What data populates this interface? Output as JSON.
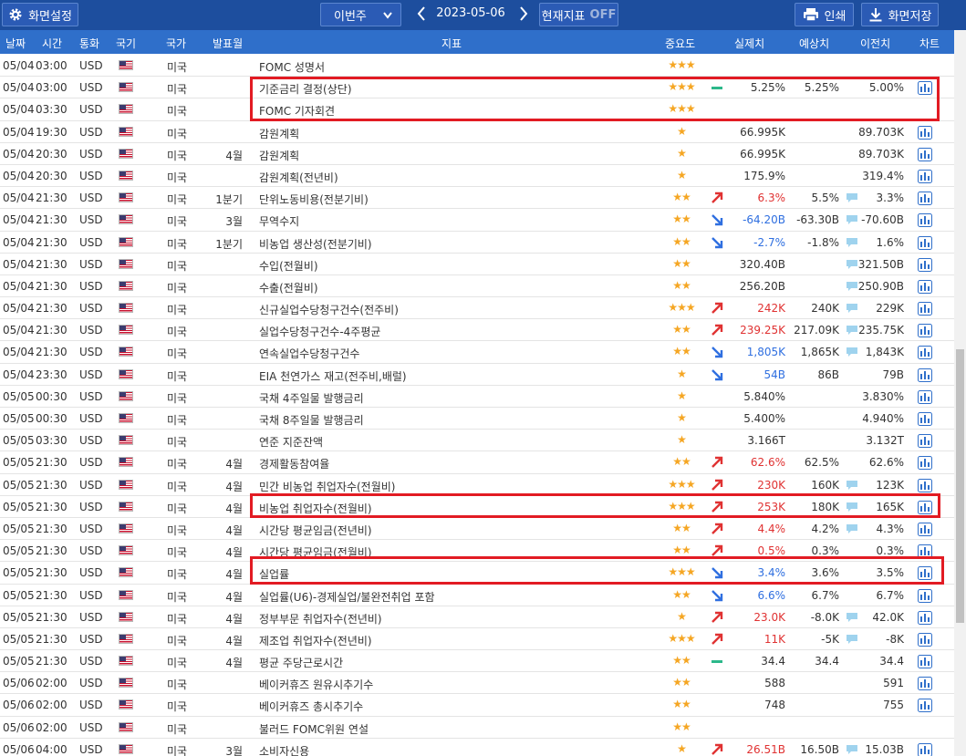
{
  "toolbar": {
    "settings_label": "화면설정",
    "week_select": "이번주",
    "date": "2023-05-06",
    "current_indicator_label": "현재지표",
    "current_indicator_state": "OFF",
    "print_label": "인쇄",
    "save_label": "화면저장"
  },
  "columns": {
    "date": "날짜",
    "time": "시간",
    "currency": "통화",
    "flag": "국기",
    "country": "국가",
    "release_month": "발표월",
    "indicator": "지표",
    "importance": "중요도",
    "actual": "실제치",
    "forecast": "예상치",
    "previous": "이전치",
    "chart": "차트"
  },
  "colors": {
    "toolbar": "#1d4e9e",
    "header": "#2f6fca",
    "star": "#f5a623",
    "up": "#e03232",
    "down": "#2f6fe0",
    "highlight": "#e21b23"
  },
  "rows": [
    {
      "date": "05/04",
      "time": "03:00",
      "currency": "USD",
      "country": "미국",
      "month": "",
      "name": "FOMC 성명서",
      "stars": 3,
      "trend": "",
      "actual": "",
      "actual_dir": "",
      "forecast": "",
      "bubble": false,
      "previous": "",
      "chart": false
    },
    {
      "date": "05/04",
      "time": "03:00",
      "currency": "USD",
      "country": "미국",
      "month": "",
      "name": "기준금리 결정(상단)",
      "stars": 3,
      "trend": "flat",
      "actual": "5.25%",
      "actual_dir": "",
      "forecast": "5.25%",
      "bubble": false,
      "previous": "5.00%",
      "chart": true
    },
    {
      "date": "05/04",
      "time": "03:30",
      "currency": "USD",
      "country": "미국",
      "month": "",
      "name": "FOMC 기자회견",
      "stars": 3,
      "trend": "",
      "actual": "",
      "actual_dir": "",
      "forecast": "",
      "bubble": false,
      "previous": "",
      "chart": false
    },
    {
      "date": "05/04",
      "time": "19:30",
      "currency": "USD",
      "country": "미국",
      "month": "",
      "name": "감원계획",
      "stars": 1,
      "trend": "",
      "actual": "66.995K",
      "actual_dir": "",
      "forecast": "",
      "bubble": false,
      "previous": "89.703K",
      "chart": true
    },
    {
      "date": "05/04",
      "time": "20:30",
      "currency": "USD",
      "country": "미국",
      "month": "4월",
      "name": "감원계획",
      "stars": 1,
      "trend": "",
      "actual": "66.995K",
      "actual_dir": "",
      "forecast": "",
      "bubble": false,
      "previous": "89.703K",
      "chart": true
    },
    {
      "date": "05/04",
      "time": "20:30",
      "currency": "USD",
      "country": "미국",
      "month": "",
      "name": "감원계획(전년비)",
      "stars": 1,
      "trend": "",
      "actual": "175.9%",
      "actual_dir": "",
      "forecast": "",
      "bubble": false,
      "previous": "319.4%",
      "chart": true
    },
    {
      "date": "05/04",
      "time": "21:30",
      "currency": "USD",
      "country": "미국",
      "month": "1분기",
      "name": "단위노동비용(전분기비)",
      "stars": 2,
      "trend": "up",
      "actual": "6.3%",
      "actual_dir": "up",
      "forecast": "5.5%",
      "bubble": true,
      "previous": "3.3%",
      "chart": true
    },
    {
      "date": "05/04",
      "time": "21:30",
      "currency": "USD",
      "country": "미국",
      "month": "3월",
      "name": "무역수지",
      "stars": 2,
      "trend": "down",
      "actual": "-64.20B",
      "actual_dir": "down",
      "forecast": "-63.30B",
      "bubble": true,
      "previous": "-70.60B",
      "chart": true
    },
    {
      "date": "05/04",
      "time": "21:30",
      "currency": "USD",
      "country": "미국",
      "month": "1분기",
      "name": "비농업 생산성(전분기비)",
      "stars": 2,
      "trend": "down",
      "actual": "-2.7%",
      "actual_dir": "down",
      "forecast": "-1.8%",
      "bubble": true,
      "previous": "1.6%",
      "chart": true
    },
    {
      "date": "05/04",
      "time": "21:30",
      "currency": "USD",
      "country": "미국",
      "month": "",
      "name": "수입(전월비)",
      "stars": 2,
      "trend": "",
      "actual": "320.40B",
      "actual_dir": "",
      "forecast": "",
      "bubble": true,
      "previous": "321.50B",
      "chart": true
    },
    {
      "date": "05/04",
      "time": "21:30",
      "currency": "USD",
      "country": "미국",
      "month": "",
      "name": "수출(전월비)",
      "stars": 2,
      "trend": "",
      "actual": "256.20B",
      "actual_dir": "",
      "forecast": "",
      "bubble": true,
      "previous": "250.90B",
      "chart": true
    },
    {
      "date": "05/04",
      "time": "21:30",
      "currency": "USD",
      "country": "미국",
      "month": "",
      "name": "신규실업수당청구건수(전주비)",
      "stars": 3,
      "trend": "up",
      "actual": "242K",
      "actual_dir": "up",
      "forecast": "240K",
      "bubble": true,
      "previous": "229K",
      "chart": true
    },
    {
      "date": "05/04",
      "time": "21:30",
      "currency": "USD",
      "country": "미국",
      "month": "",
      "name": "실업수당청구건수-4주평균",
      "stars": 2,
      "trend": "up",
      "actual": "239.25K",
      "actual_dir": "up",
      "forecast": "217.09K",
      "bubble": true,
      "previous": "235.75K",
      "chart": true
    },
    {
      "date": "05/04",
      "time": "21:30",
      "currency": "USD",
      "country": "미국",
      "month": "",
      "name": "연속실업수당청구건수",
      "stars": 2,
      "trend": "down",
      "actual": "1,805K",
      "actual_dir": "down",
      "forecast": "1,865K",
      "bubble": true,
      "previous": "1,843K",
      "chart": true
    },
    {
      "date": "05/04",
      "time": "23:30",
      "currency": "USD",
      "country": "미국",
      "month": "",
      "name": "EIA 천연가스 재고(전주비,배럴)",
      "stars": 1,
      "trend": "down",
      "actual": "54B",
      "actual_dir": "down",
      "forecast": "86B",
      "bubble": false,
      "previous": "79B",
      "chart": true
    },
    {
      "date": "05/05",
      "time": "00:30",
      "currency": "USD",
      "country": "미국",
      "month": "",
      "name": "국채 4주일물 발행금리",
      "stars": 1,
      "trend": "",
      "actual": "5.840%",
      "actual_dir": "",
      "forecast": "",
      "bubble": false,
      "previous": "3.830%",
      "chart": true
    },
    {
      "date": "05/05",
      "time": "00:30",
      "currency": "USD",
      "country": "미국",
      "month": "",
      "name": "국채 8주일물 발행금리",
      "stars": 1,
      "trend": "",
      "actual": "5.400%",
      "actual_dir": "",
      "forecast": "",
      "bubble": false,
      "previous": "4.940%",
      "chart": true
    },
    {
      "date": "05/05",
      "time": "03:30",
      "currency": "USD",
      "country": "미국",
      "month": "",
      "name": "연준 지준잔액",
      "stars": 1,
      "trend": "",
      "actual": "3.166T",
      "actual_dir": "",
      "forecast": "",
      "bubble": false,
      "previous": "3.132T",
      "chart": true
    },
    {
      "date": "05/05",
      "time": "21:30",
      "currency": "USD",
      "country": "미국",
      "month": "4월",
      "name": "경제활동참여율",
      "stars": 2,
      "trend": "up",
      "actual": "62.6%",
      "actual_dir": "up",
      "forecast": "62.5%",
      "bubble": false,
      "previous": "62.6%",
      "chart": true
    },
    {
      "date": "05/05",
      "time": "21:30",
      "currency": "USD",
      "country": "미국",
      "month": "4월",
      "name": "민간 비농업 취업자수(전월비)",
      "stars": 3,
      "trend": "up",
      "actual": "230K",
      "actual_dir": "up",
      "forecast": "160K",
      "bubble": true,
      "previous": "123K",
      "chart": true
    },
    {
      "date": "05/05",
      "time": "21:30",
      "currency": "USD",
      "country": "미국",
      "month": "4월",
      "name": "비농업 취업자수(전월비)",
      "stars": 3,
      "trend": "up",
      "actual": "253K",
      "actual_dir": "up",
      "forecast": "180K",
      "bubble": true,
      "previous": "165K",
      "chart": true
    },
    {
      "date": "05/05",
      "time": "21:30",
      "currency": "USD",
      "country": "미국",
      "month": "4월",
      "name": "시간당 평균임금(전년비)",
      "stars": 2,
      "trend": "up",
      "actual": "4.4%",
      "actual_dir": "up",
      "forecast": "4.2%",
      "bubble": true,
      "previous": "4.3%",
      "chart": true
    },
    {
      "date": "05/05",
      "time": "21:30",
      "currency": "USD",
      "country": "미국",
      "month": "4월",
      "name": "시간당 평균임금(전월비)",
      "stars": 2,
      "trend": "up",
      "actual": "0.5%",
      "actual_dir": "up",
      "forecast": "0.3%",
      "bubble": false,
      "previous": "0.3%",
      "chart": true
    },
    {
      "date": "05/05",
      "time": "21:30",
      "currency": "USD",
      "country": "미국",
      "month": "4월",
      "name": "실업률",
      "stars": 3,
      "trend": "down",
      "actual": "3.4%",
      "actual_dir": "down",
      "forecast": "3.6%",
      "bubble": false,
      "previous": "3.5%",
      "chart": true
    },
    {
      "date": "05/05",
      "time": "21:30",
      "currency": "USD",
      "country": "미국",
      "month": "4월",
      "name": "실업률(U6)-경제실업/불완전취업 포함",
      "stars": 2,
      "trend": "down",
      "actual": "6.6%",
      "actual_dir": "down",
      "forecast": "6.7%",
      "bubble": false,
      "previous": "6.7%",
      "chart": true
    },
    {
      "date": "05/05",
      "time": "21:30",
      "currency": "USD",
      "country": "미국",
      "month": "4월",
      "name": "정부부문 취업자수(전년비)",
      "stars": 1,
      "trend": "up",
      "actual": "23.0K",
      "actual_dir": "up",
      "forecast": "-8.0K",
      "bubble": true,
      "previous": "42.0K",
      "chart": true
    },
    {
      "date": "05/05",
      "time": "21:30",
      "currency": "USD",
      "country": "미국",
      "month": "4월",
      "name": "제조업 취업자수(전년비)",
      "stars": 3,
      "trend": "up",
      "actual": "11K",
      "actual_dir": "up",
      "forecast": "-5K",
      "bubble": true,
      "previous": "-8K",
      "chart": true
    },
    {
      "date": "05/05",
      "time": "21:30",
      "currency": "USD",
      "country": "미국",
      "month": "4월",
      "name": "평균 주당근로시간",
      "stars": 2,
      "trend": "flat",
      "actual": "34.4",
      "actual_dir": "",
      "forecast": "34.4",
      "bubble": false,
      "previous": "34.4",
      "chart": true
    },
    {
      "date": "05/06",
      "time": "02:00",
      "currency": "USD",
      "country": "미국",
      "month": "",
      "name": "베이커휴즈 원유시추기수",
      "stars": 2,
      "trend": "",
      "actual": "588",
      "actual_dir": "",
      "forecast": "",
      "bubble": false,
      "previous": "591",
      "chart": true
    },
    {
      "date": "05/06",
      "time": "02:00",
      "currency": "USD",
      "country": "미국",
      "month": "",
      "name": "베이커휴즈 총시추기수",
      "stars": 2,
      "trend": "",
      "actual": "748",
      "actual_dir": "",
      "forecast": "",
      "bubble": false,
      "previous": "755",
      "chart": true
    },
    {
      "date": "05/06",
      "time": "02:00",
      "currency": "USD",
      "country": "미국",
      "month": "",
      "name": "불러드 FOMC위원 연설",
      "stars": 2,
      "trend": "",
      "actual": "",
      "actual_dir": "",
      "forecast": "",
      "bubble": false,
      "previous": "",
      "chart": false
    },
    {
      "date": "05/06",
      "time": "04:00",
      "currency": "USD",
      "country": "미국",
      "month": "3월",
      "name": "소비자신용",
      "stars": 1,
      "trend": "up",
      "actual": "26.51B",
      "actual_dir": "up",
      "forecast": "16.50B",
      "bubble": true,
      "previous": "15.03B",
      "chart": true
    }
  ]
}
